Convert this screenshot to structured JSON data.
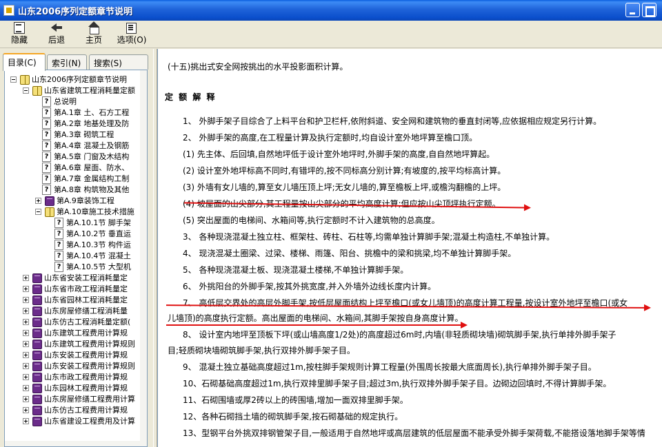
{
  "window": {
    "title": "山东2006序列定额章节说明"
  },
  "toolbar": {
    "hide_label": "隐藏",
    "back_label": "后退",
    "home_label": "主页",
    "options_label": "选项(O)"
  },
  "tabs": {
    "contents": "目录(C)",
    "index": "索引(N)",
    "search": "搜索(S)"
  },
  "tree": [
    {
      "label": "山东2006序列定额章节说明",
      "level": 0,
      "kind": "book-open",
      "expander": "minus"
    },
    {
      "label": "山东省建筑工程消耗量定额",
      "level": 1,
      "kind": "book-open",
      "expander": "minus"
    },
    {
      "label": "总说明",
      "level": 2,
      "kind": "page"
    },
    {
      "label": "第A.1章 土、石方工程",
      "level": 2,
      "kind": "page"
    },
    {
      "label": "第A.2章 地基处理及防",
      "level": 2,
      "kind": "page"
    },
    {
      "label": "第A.3章 砌筑工程",
      "level": 2,
      "kind": "page"
    },
    {
      "label": "第A.4章 混凝土及钢筋",
      "level": 2,
      "kind": "page"
    },
    {
      "label": "第A.5章 门窗及木结构",
      "level": 2,
      "kind": "page"
    },
    {
      "label": "第A.6章 屋面、防水、",
      "level": 2,
      "kind": "page"
    },
    {
      "label": "第A.7章 金属结构工制",
      "level": 2,
      "kind": "page"
    },
    {
      "label": "第A.8章 构筑物及其他",
      "level": 2,
      "kind": "page"
    },
    {
      "label": "第A.9章装饰工程",
      "level": 2,
      "kind": "book-closed",
      "expander": "plus"
    },
    {
      "label": "第A.10章施工技术措施",
      "level": 2,
      "kind": "book-open",
      "expander": "minus"
    },
    {
      "label": "第A.10.1节 脚手架",
      "level": 3,
      "kind": "page"
    },
    {
      "label": "第A.10.2节 垂直运",
      "level": 3,
      "kind": "page"
    },
    {
      "label": "第A.10.3节 构件运",
      "level": 3,
      "kind": "page"
    },
    {
      "label": "第A.10.4节 混凝土",
      "level": 3,
      "kind": "page"
    },
    {
      "label": "第A.10.5节 大型机",
      "level": 3,
      "kind": "page"
    },
    {
      "label": "山东省安装工程消耗量定",
      "level": 1,
      "kind": "book-closed",
      "expander": "plus"
    },
    {
      "label": "山东省市政工程消耗量定",
      "level": 1,
      "kind": "book-closed",
      "expander": "plus"
    },
    {
      "label": "山东省园林工程消耗量定",
      "level": 1,
      "kind": "book-closed",
      "expander": "plus"
    },
    {
      "label": "山东房屋修缮工程消耗量",
      "level": 1,
      "kind": "book-closed",
      "expander": "plus"
    },
    {
      "label": "山东仿古工程消耗量定额(",
      "level": 1,
      "kind": "book-closed",
      "expander": "plus"
    },
    {
      "label": "山东建筑工程费用计算规",
      "level": 1,
      "kind": "book-closed",
      "expander": "plus"
    },
    {
      "label": "山东建筑工程费用计算规则",
      "level": 1,
      "kind": "book-closed",
      "expander": "plus"
    },
    {
      "label": "山东安装工程费用计算规",
      "level": 1,
      "kind": "book-closed",
      "expander": "plus"
    },
    {
      "label": "山东安装工程费用计算规则",
      "level": 1,
      "kind": "book-closed",
      "expander": "plus"
    },
    {
      "label": "山东市政工程费用计算规",
      "level": 1,
      "kind": "book-closed",
      "expander": "plus"
    },
    {
      "label": "山东园林工程费用计算规",
      "level": 1,
      "kind": "book-closed",
      "expander": "plus"
    },
    {
      "label": "山东房屋修缮工程费用计算",
      "level": 1,
      "kind": "book-closed",
      "expander": "plus"
    },
    {
      "label": "山东仿古工程费用计算规",
      "level": 1,
      "kind": "book-closed",
      "expander": "plus"
    },
    {
      "label": "山东省建设工程费用及计算",
      "level": 1,
      "kind": "book-closed",
      "expander": "plus"
    }
  ],
  "content": {
    "intro": "(十五)挑出式安全网按挑出的水平投影面积计算。",
    "heading": "定 额 解 释",
    "items": [
      "1、 外脚手架子目综合了上料平台和护卫栏杆,依附斜道、安全网和建筑物的垂直封闭等,应依据相应规定另行计算。",
      "2、 外脚手架的高度,在工程量计算及执行定额时,均自设计室外地坪算至檐口顶。",
      "(1) 先主体、后回填,自然地坪低于设计室外地坪时,外脚手架的高度,自自然地坪算起。",
      "(2) 设计室外地坪标高不同时,有错坪的,按不同标高分别计算;有坡度的,按平均标高计算。",
      "(3) 外墙有女儿墙的,算至女儿墙压顶上坪;无女儿墙的,算至檐板上坪,或檐沟翻檐的上坪。",
      "(4) 坡屋面的山尖部分,其工程量按山尖部分的平均高度计算;但应按山尖顶坪执行定额。",
      "(5) 突出屋面的电梯间、水箱间等,执行定额时不计入建筑物的总高度。",
      "3、 各种现浇混凝土独立柱、框架柱、砖柱、石柱等,均需单独计算脚手架;混凝土构造柱,不单独计算。",
      "4、 现浇混凝土圈梁、过梁、楼梯、雨篷、阳台、挑檐中的梁和挑梁,均不单独计算脚手架。",
      "5、 各种现浇混凝土板、现浇混凝土楼梯,不单独计算脚手架。",
      "6、 外挑阳台的外脚手架,按其外挑宽度,并入外墙外边线长度内计算。",
      "7、 高低层交界处的高层外脚手架,按低层屋面结构上坪至檐口(或女儿墙顶)的高度计算工程量,按设计室外地坪至檐口(或女",
      "儿墙顶)的高度执行定额。高出屋面的电梯间、水箱间,其脚手架按自身高度计算。",
      "8、 设计室内地坪至顶板下坪(或山墙高度1/2处)的高度超过6m时,内墙(非轻质砌块墙)砌筑脚手架,执行单排外脚手架子",
      "目;轻质砌块墙砌筑脚手架,执行双排外脚手架子目。",
      "9、 混凝土独立基础高度超过1m,按柱脚手架规则计算工程量(外围周长按最大底面周长),执行单排外脚手架子目。",
      "10、石砌基础高度超过1m,执行双排里脚手架子目;超过3m,执行双排外脚手架子目。边砌边回填时,不得计算脚手架。",
      "11、石砌围墙或厚2砖以上的砖围墙,增加一面双排里脚手架。",
      "12、各种石砌挡土墙的砌筑脚手架,按石砌基础的规定执行。",
      "13、型钢平台外挑双排钢管架子目,一般适用于自然地坪或高层建筑的低层屋面不能承受外脚手架荷载,不能搭设落地脚手架等情"
    ]
  },
  "colors": {
    "annotation": "#e01010",
    "titlebar": "#0b4fcc"
  }
}
